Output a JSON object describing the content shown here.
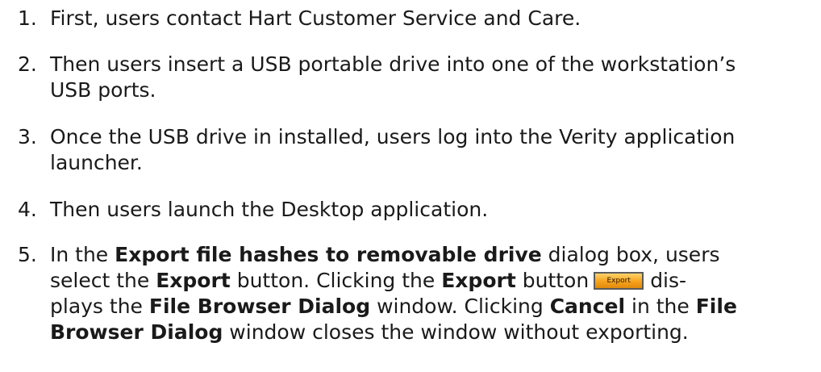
{
  "steps": [
    {
      "number": "1.",
      "lines": [
        "First, users contact Hart Customer Service and Care."
      ]
    },
    {
      "number": "2.",
      "lines": [
        "Then users insert a USB portable drive into one of the workstation’s",
        "USB ports."
      ]
    },
    {
      "number": "3.",
      "lines": [
        "Once the USB drive in installed, users log into the Verity application",
        "launcher."
      ]
    },
    {
      "number": "4.",
      "lines": [
        "Then users launch the Desktop application."
      ]
    },
    {
      "number": "5.",
      "l1a": "In the ",
      "l1b": "Export file hashes to removable drive",
      "l1c": " dialog box, users",
      "l2a": "select the ",
      "l2b": "Export",
      "l2c": " button. Clicking the ",
      "l2d": "Export",
      "l2e": " button",
      "button_label": "Export",
      "l2f": "dis-",
      "l3a": "plays the ",
      "l3b": "File Browser Dialog",
      "l3c": " window. Clicking ",
      "l3d": "Cancel",
      "l3e": " in the ",
      "l3f": "File",
      "l4a": "Browser Dialog",
      "l4b": " window closes the window without exporting."
    }
  ],
  "colors": {
    "text": "#1a1a1a",
    "button_fill": "#f6a21d",
    "button_border": "#5b5b5b"
  }
}
